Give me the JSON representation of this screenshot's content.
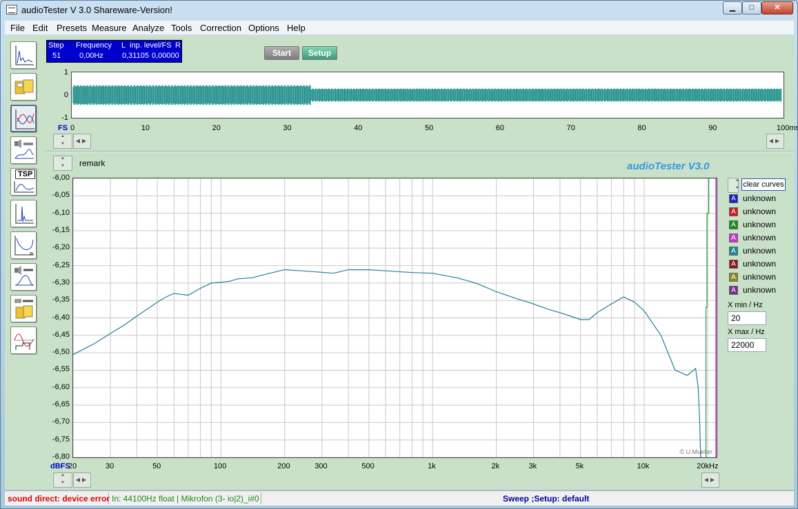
{
  "window": {
    "title": "audioTester  V 3.0 Shareware-Version!",
    "min_label": "▁",
    "max_label": "□",
    "close_label": "✕"
  },
  "menu": [
    "File",
    "Edit",
    "Presets",
    "Measure",
    "Analyze",
    "Tools",
    "Correction",
    "Options",
    "Help"
  ],
  "toolbox": [
    "fft-display-icon",
    "tape-recorder-icon",
    "frequency-response-icon",
    "speaker-measure-icon",
    "tsp-icon",
    "impulse-icon",
    "distortion-icon",
    "speaker-response-icon",
    "tape-measure-icon",
    "scope-icon"
  ],
  "tsp_label": "TSP",
  "readout": {
    "headers": [
      "Step",
      "Frequency",
      "L",
      "inp. level/FS",
      "R"
    ],
    "step": "51",
    "frequency": "0,00Hz",
    "left": "0,31105",
    "right": "0,00000"
  },
  "buttons": {
    "start": "Start",
    "setup": "Setup"
  },
  "oscilloscope": {
    "y_ticks": [
      "1",
      "0",
      "-1"
    ],
    "x_ticks": [
      "0",
      "10",
      "20",
      "30",
      "40",
      "50",
      "60",
      "70",
      "80",
      "90",
      "100ms"
    ],
    "y_unit": "FS",
    "color": "#1f8f8a",
    "series": [
      {
        "x_range_ms": [
          0,
          33.5
        ],
        "amplitude": 0.45
      },
      {
        "x_range_ms": [
          33.5,
          100
        ],
        "amplitude": 0.3
      }
    ]
  },
  "remark": "remark",
  "brand": "audioTester  V3.0",
  "copyright": "© U.Mueller",
  "chart_data": {
    "type": "line",
    "xscale": "log",
    "xlim": [
      20,
      22000
    ],
    "ylim": [
      -6.8,
      -6.0
    ],
    "ylabel": "dBFS",
    "y_ticks": [
      "-6,00",
      "-6,05",
      "-6,10",
      "-6,15",
      "-6,20",
      "-6,25",
      "-6,30",
      "-6,35",
      "-6,40",
      "-6,45",
      "-6,50",
      "-6,55",
      "-6,60",
      "-6,65",
      "-6,70",
      "-6,75",
      "-6,80"
    ],
    "x_ticks": [
      {
        "value": 20,
        "label": "20"
      },
      {
        "value": 30,
        "label": "30"
      },
      {
        "value": 50,
        "label": "50"
      },
      {
        "value": 100,
        "label": "100"
      },
      {
        "value": 200,
        "label": "200"
      },
      {
        "value": 300,
        "label": "300"
      },
      {
        "value": 500,
        "label": "500"
      },
      {
        "value": 1000,
        "label": "1k"
      },
      {
        "value": 2000,
        "label": "2k"
      },
      {
        "value": 3000,
        "label": "3k"
      },
      {
        "value": 5000,
        "label": "5k"
      },
      {
        "value": 10000,
        "label": "10k"
      },
      {
        "value": 20000,
        "label": "20kHz"
      }
    ],
    "series": [
      {
        "color": "#1f7f96",
        "x": [
          20,
          25,
          30,
          35,
          40,
          50,
          55,
          60,
          70,
          80,
          90,
          100,
          110,
          120,
          140,
          170,
          200,
          240,
          280,
          340,
          400,
          500,
          600,
          800,
          1000,
          1300,
          1600,
          2000,
          2500,
          3000,
          3500,
          4000,
          4500,
          5000,
          5500,
          6000,
          7000,
          8000,
          9000,
          10000,
          12000,
          14000,
          16000,
          17500,
          18000,
          18300,
          18500
        ],
        "y": [
          -6.505,
          -6.475,
          -6.445,
          -6.42,
          -6.395,
          -6.355,
          -6.34,
          -6.33,
          -6.335,
          -6.315,
          -6.3,
          -6.298,
          -6.295,
          -6.288,
          -6.285,
          -6.272,
          -6.262,
          -6.265,
          -6.268,
          -6.272,
          -6.262,
          -6.262,
          -6.265,
          -6.27,
          -6.272,
          -6.285,
          -6.3,
          -6.325,
          -6.345,
          -6.36,
          -6.375,
          -6.385,
          -6.395,
          -6.405,
          -6.405,
          -6.385,
          -6.36,
          -6.34,
          -6.355,
          -6.38,
          -6.45,
          -6.55,
          -6.565,
          -6.545,
          -6.6,
          -6.7,
          -6.8
        ]
      },
      {
        "color": "#1f9a3a",
        "x": [
          19600,
          19600,
          19800,
          19800,
          20200,
          20200
        ],
        "y": [
          -6.8,
          -6.37,
          -6.37,
          -6.1,
          -6.1,
          -6.0
        ]
      }
    ],
    "cursor": {
      "color": "#dd33dd",
      "x": 22000
    }
  },
  "legend": {
    "clear_label": "clear curves",
    "items": [
      {
        "label": "unknown",
        "color": "#1a1acc"
      },
      {
        "label": "unknown",
        "color": "#cc1a1a"
      },
      {
        "label": "unknown",
        "color": "#1a8a1a"
      },
      {
        "label": "unknown",
        "color": "#cc33cc"
      },
      {
        "label": "unknown",
        "color": "#1a8a8a"
      },
      {
        "label": "unknown",
        "color": "#881a1a"
      },
      {
        "label": "unknown",
        "color": "#8a8a1a"
      },
      {
        "label": "unknown",
        "color": "#7a2a8a"
      }
    ]
  },
  "xrange": {
    "min_label": "min / Hz",
    "min_value": "20",
    "max_label": "max / Hz",
    "max_value": "22000"
  },
  "status": {
    "error": "sound direct: device error",
    "input": "In: 44100Hz float  | Mikrofon (3- io|2)_i#0",
    "mode": "Sweep  ;Setup:  default"
  }
}
